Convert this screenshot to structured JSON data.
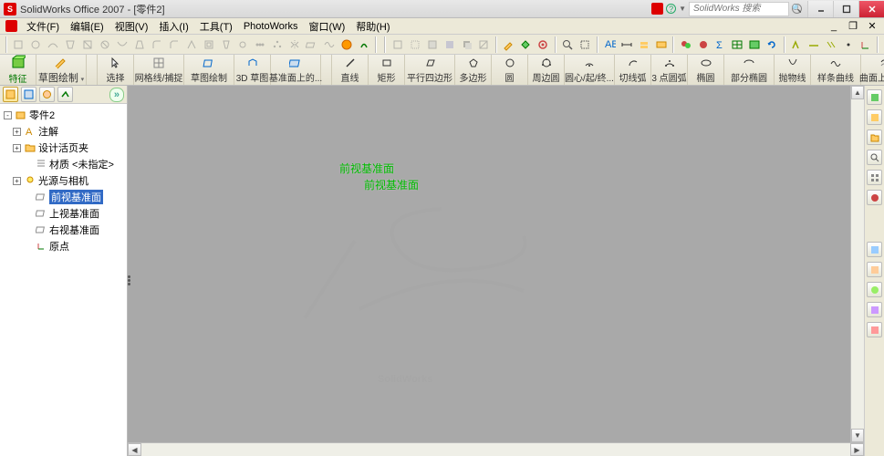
{
  "title": "SolidWorks Office 2007 - [零件2]",
  "search_placeholder": "SolidWorks 搜索",
  "menu": [
    "文件(F)",
    "编辑(E)",
    "视图(V)",
    "插入(I)",
    "工具(T)",
    "PhotoWorks",
    "窗口(W)",
    "帮助(H)"
  ],
  "ribbon": [
    {
      "label": "特征",
      "color": "green"
    },
    {
      "label": "草图绘制"
    },
    {
      "label": "选择"
    },
    {
      "label": "网格线/捕捉"
    },
    {
      "label": "草图绘制"
    },
    {
      "label": "3D 草图"
    },
    {
      "label": "基准面上的..."
    },
    {
      "label": "直线"
    },
    {
      "label": "矩形"
    },
    {
      "label": "平行四边形"
    },
    {
      "label": "多边形"
    },
    {
      "label": "圆"
    },
    {
      "label": "周边圆"
    },
    {
      "label": "圆心/起/终..."
    },
    {
      "label": "切线弧"
    },
    {
      "label": "3 点圆弧"
    },
    {
      "label": "椭圆"
    },
    {
      "label": "部分椭圆"
    },
    {
      "label": "抛物线"
    },
    {
      "label": "样条曲线"
    },
    {
      "label": "曲面上的样..."
    }
  ],
  "tree": {
    "root": "零件2",
    "nodes": [
      {
        "label": "注解",
        "icon": "annot",
        "exp": "+",
        "lvl": 1
      },
      {
        "label": "设计活页夹",
        "icon": "folder",
        "exp": "+",
        "lvl": 1
      },
      {
        "label": "材质 <未指定>",
        "icon": "material",
        "exp": "",
        "lvl": 2
      },
      {
        "label": "光源与相机",
        "icon": "light",
        "exp": "+",
        "lvl": 1
      },
      {
        "label": "前视基准面",
        "icon": "plane",
        "exp": "",
        "lvl": 2,
        "sel": true
      },
      {
        "label": "上视基准面",
        "icon": "plane",
        "exp": "",
        "lvl": 2
      },
      {
        "label": "右视基准面",
        "icon": "plane",
        "exp": "",
        "lvl": 2
      },
      {
        "label": "原点",
        "icon": "origin",
        "exp": "",
        "lvl": 2
      }
    ]
  },
  "viewport": {
    "plane_label_1": "前视基准面",
    "plane_label_2": "前视基准面",
    "watermark": "SolidWorks"
  }
}
